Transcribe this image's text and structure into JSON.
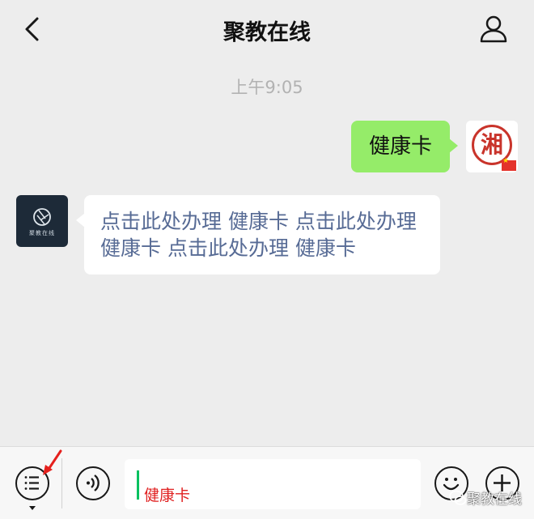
{
  "header": {
    "title": "聚教在线",
    "back_icon": "chevron-left-icon",
    "profile_icon": "person-icon"
  },
  "chat": {
    "timestamp": "上午9:05",
    "messages": [
      {
        "sender": "self",
        "text": "健康卡",
        "avatar_text": "湘",
        "bubble_color": "#95ec69"
      },
      {
        "sender": "other",
        "text": "点击此处办理 健康卡 点击此处办理 健康卡 点击此处办理 健康卡",
        "link_color": "#576b95",
        "avatar_text": "聚教在线"
      }
    ]
  },
  "input_bar": {
    "current_value": "健康卡",
    "icons": [
      "menu-icon",
      "voice-icon",
      "emoji-icon",
      "plus-icon"
    ],
    "text_color": "#e02020"
  },
  "watermark": {
    "text": "聚教在线"
  }
}
